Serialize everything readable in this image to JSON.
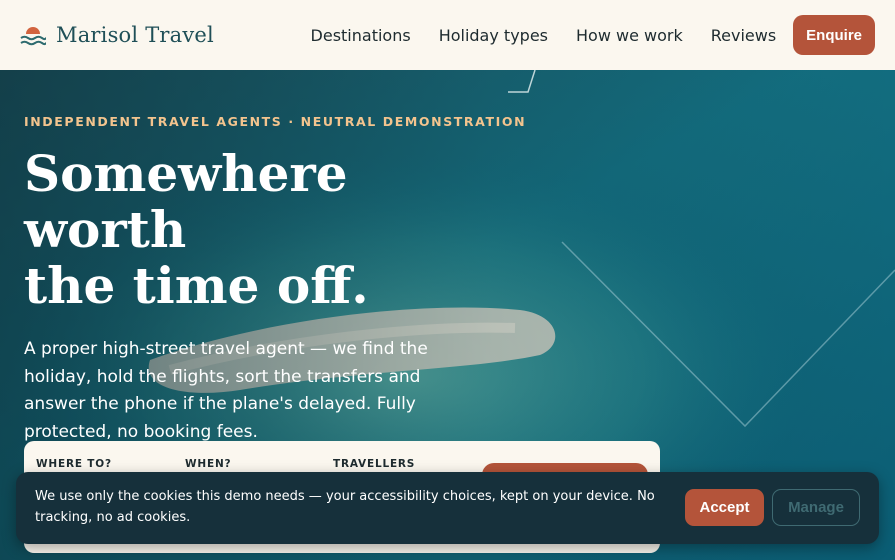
{
  "brand": {
    "name": "Marisol Travel"
  },
  "nav": {
    "links": [
      "Destinations",
      "Holiday types",
      "How we work",
      "Reviews"
    ],
    "cta": "Enquire"
  },
  "hero": {
    "eyebrow": "INDEPENDENT TRAVEL AGENTS · NEUTRAL DEMONSTRATION",
    "headline": [
      "Somewhere",
      "worth",
      "the time off."
    ],
    "lead": "A proper high-street travel agent — we find the holiday, hold the flights, sort the transfers and answer the phone if the plane's delayed. Fully protected, no booking fees."
  },
  "search": {
    "labels": [
      "WHERE TO?",
      "WHEN?",
      "TRAVELLERS"
    ]
  },
  "cookie": {
    "text": "We use only the cookies this demo needs — your accessibility choices, kept on your device. No tracking, no ad cookies.",
    "accept": "Accept",
    "manage": "Manage"
  },
  "colors": {
    "accent": "#b4543a",
    "header_bg": "#fbf7ef",
    "eyebrow": "#f3c48e",
    "cookie_bg": "#16303b"
  }
}
